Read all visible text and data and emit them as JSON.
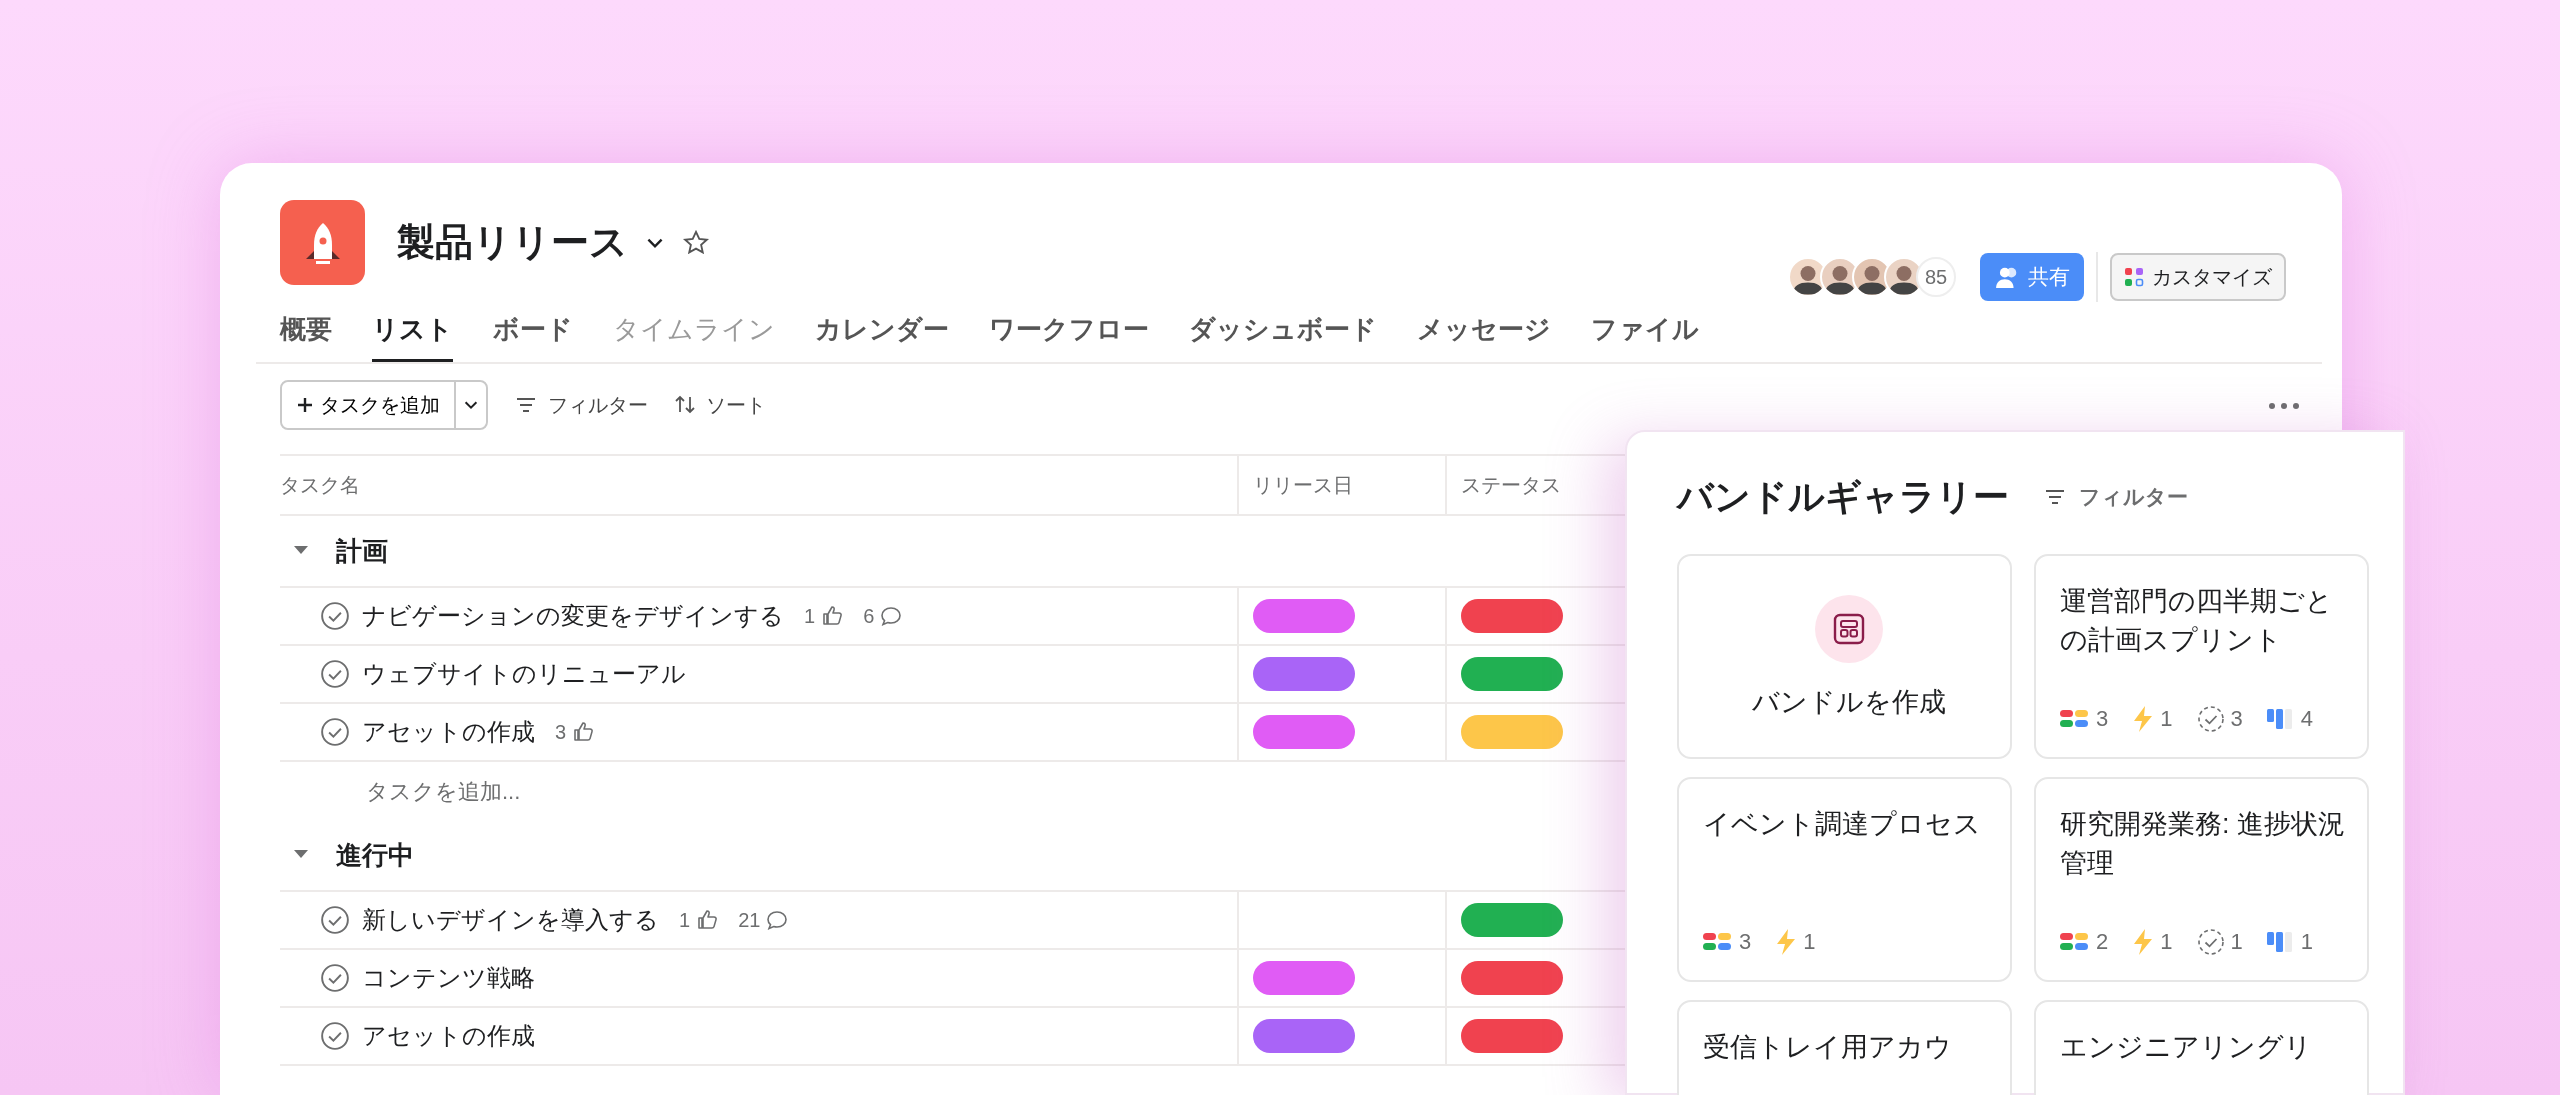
{
  "project": {
    "title": "製品リリース"
  },
  "tabs": [
    {
      "label": "概要",
      "selected": false,
      "muted": false
    },
    {
      "label": "リスト",
      "selected": true,
      "muted": false
    },
    {
      "label": "ボード",
      "selected": false,
      "muted": false
    },
    {
      "label": "タイムライン",
      "selected": false,
      "muted": true
    },
    {
      "label": "カレンダー",
      "selected": false,
      "muted": false
    },
    {
      "label": "ワークフロー",
      "selected": false,
      "muted": false
    },
    {
      "label": "ダッシュボード",
      "selected": false,
      "muted": false
    },
    {
      "label": "メッセージ",
      "selected": false,
      "muted": false
    },
    {
      "label": "ファイル",
      "selected": false,
      "muted": false
    }
  ],
  "members": {
    "count": "85"
  },
  "share_button": "共有",
  "customize_button": "カスタマイズ",
  "toolbar": {
    "add_task": "タスクを追加",
    "filter": "フィルター",
    "sort": "ソート"
  },
  "table": {
    "columns": [
      "タスク名",
      "リリース日",
      "ステータス"
    ],
    "sections": [
      {
        "name": "計画",
        "expanded": true,
        "add_task": "タスクを追加...",
        "tasks": [
          {
            "name": "ナビゲーションの変更をデザインする",
            "completed": false,
            "likes": "1",
            "comments": "6",
            "release": {
              "color": "#e05cf5"
            },
            "status": {
              "color": "#f0424f"
            }
          },
          {
            "name": "ウェブサイトのリニューアル",
            "completed": false,
            "release": {
              "color": "#a964f7"
            },
            "status": {
              "color": "#21b052"
            }
          },
          {
            "name": "アセットの作成",
            "completed": false,
            "likes": "3",
            "release": {
              "color": "#e05cf5"
            },
            "status": {
              "color": "#fdc649"
            }
          }
        ]
      },
      {
        "name": "進行中",
        "expanded": true,
        "tasks": [
          {
            "name": "新しいデザインを導入する",
            "completed": false,
            "likes": "1",
            "comments": "21",
            "status": {
              "color": "#21b052"
            }
          },
          {
            "name": "コンテンツ戦略",
            "completed": false,
            "release": {
              "color": "#e05cf5"
            },
            "status": {
              "color": "#f0424f"
            }
          },
          {
            "name": "アセットの作成",
            "completed": false,
            "release": {
              "color": "#a964f7"
            },
            "status": {
              "color": "#f0424f"
            }
          }
        ]
      }
    ]
  },
  "gallery": {
    "title": "バンドルギャラリー",
    "filter": "フィルター",
    "create_label": "バンドルを作成",
    "bundles": [
      {
        "name": "運営部門の四半期ごとの計画スプリント",
        "stats": [
          {
            "kind": "fields",
            "value": "3"
          },
          {
            "kind": "rules",
            "value": "1"
          },
          {
            "kind": "tasks",
            "value": "3"
          },
          {
            "kind": "sections",
            "value": "4"
          }
        ]
      },
      {
        "name": "イベント調達プロセス",
        "stats": [
          {
            "kind": "fields",
            "value": "3"
          },
          {
            "kind": "rules",
            "value": "1"
          }
        ]
      },
      {
        "name": "研究開発業務: 進捗状況管理",
        "stats": [
          {
            "kind": "fields",
            "value": "2"
          },
          {
            "kind": "rules",
            "value": "1"
          },
          {
            "kind": "tasks",
            "value": "1"
          },
          {
            "kind": "sections",
            "value": "1"
          }
        ]
      },
      {
        "name": "受信トレイ用アカウ"
      },
      {
        "name": "エンジニアリングリ"
      }
    ]
  }
}
